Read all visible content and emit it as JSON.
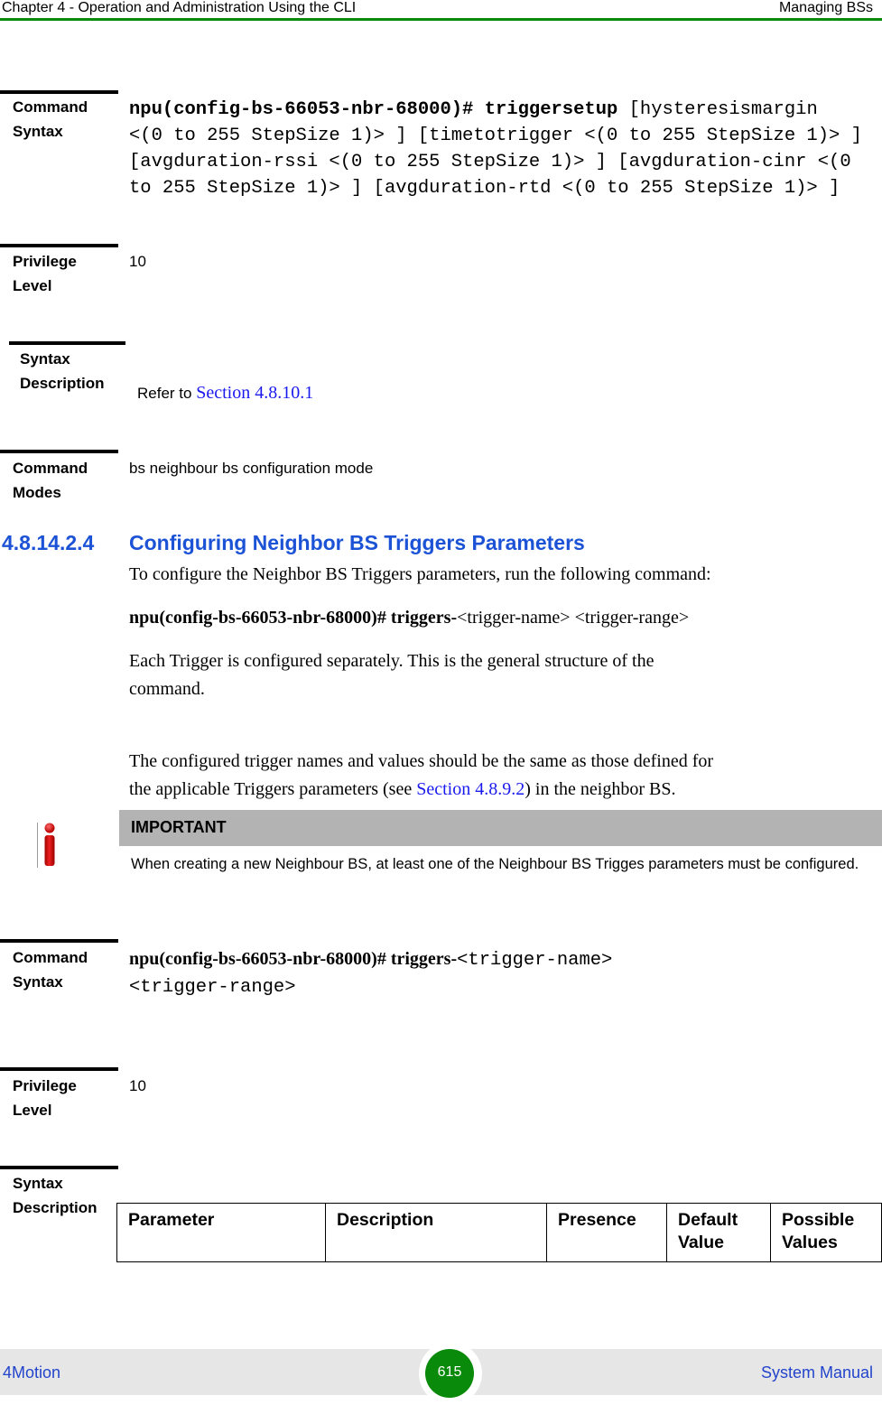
{
  "header": {
    "chapter": "Chapter 4 - Operation and Administration Using the CLI",
    "section": "Managing BSs"
  },
  "block1": {
    "command_syntax_label": [
      "Command",
      "Syntax"
    ],
    "command_prompt": "npu(config-bs-66053-nbr-68000)#",
    "command_name": "triggersetup",
    "command_args_lines": [
      " [hysteresismargin",
      "<(0 to 255 StepSize 1)> ] [timetotrigger <(0 to 255 StepSize 1)> ]",
      "[avgduration-rssi <(0 to 255 StepSize 1)> ] [avgduration-cinr <(0",
      "to 255 StepSize 1)> ] [avgduration-rtd <(0 to 255 StepSize 1)> ]"
    ],
    "privilege_label": [
      "Privilege",
      "Level"
    ],
    "privilege_value": "10",
    "syntax_desc_label": [
      "Syntax",
      "Description"
    ],
    "syntax_desc_prefix": "Refer to ",
    "syntax_desc_link": "Section 4.8.10.1",
    "modes_label": [
      "Command",
      "Modes"
    ],
    "modes_value": "bs neighbour bs configuration mode"
  },
  "section": {
    "number": "4.8.14.2.4",
    "title": "Configuring Neighbor BS Triggers Parameters",
    "intro": "To configure the Neighbor BS Triggers parameters, run the following command:",
    "cmd_bold": "npu(config-bs-66053-nbr-68000)# triggers-",
    "cmd_rest": "<trigger-name> <trigger-range>",
    "para2": [
      "Each Trigger is configured separately. This is the general structure of the",
      "command."
    ],
    "para3_line1": "The configured trigger names and values should be the same as those defined for",
    "para3_pre": "the applicable Triggers parameters (see ",
    "para3_link": "Section 4.8.9.2",
    "para3_post": ") in the neighbor BS."
  },
  "important": {
    "icon": "info-icon",
    "title": "IMPORTANT",
    "text": "When creating a new Neighbour BS, at least one of the Neighbour BS Trigges parameters must be configured."
  },
  "block2": {
    "command_syntax_label": [
      "Command",
      "Syntax"
    ],
    "cmd_bold": "npu(config-bs-66053-nbr-68000)# triggers-",
    "cmd_mono1": "<trigger-name>",
    "cmd_mono2": "<trigger-range>",
    "privilege_label": [
      "Privilege",
      "Level"
    ],
    "privilege_value": "10",
    "syntax_desc_label": [
      "Syntax",
      "Description"
    ],
    "table_headers": [
      "Parameter",
      "Description",
      "Presence",
      "Default Value",
      "Possible Values"
    ]
  },
  "footer": {
    "left": "4Motion",
    "page": "615",
    "right": "System Manual"
  },
  "colors": {
    "accent_green": "#0a8a0a",
    "heading_blue": "#1c53d6",
    "link_blue": "#1a1aee"
  }
}
